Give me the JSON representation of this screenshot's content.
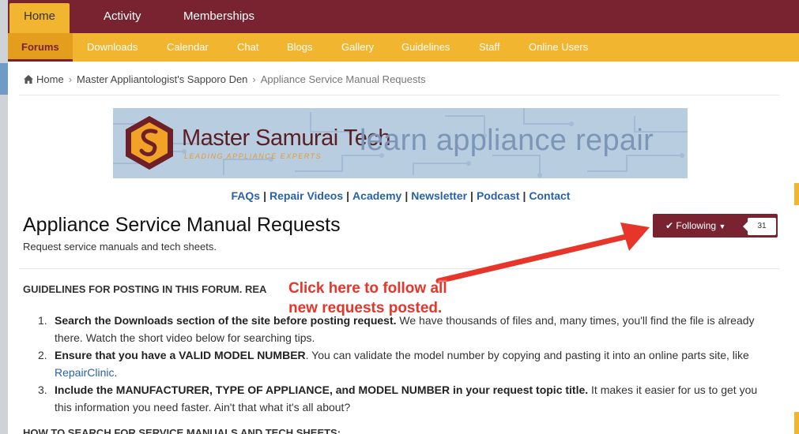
{
  "top_nav": {
    "tabs": [
      "Home",
      "Activity",
      "Memberships"
    ]
  },
  "sub_nav": {
    "items": [
      "Forums",
      "Downloads",
      "Calendar",
      "Chat",
      "Blogs",
      "Gallery",
      "Guidelines",
      "Staff",
      "Online Users"
    ]
  },
  "breadcrumb": {
    "items": [
      "Home",
      "Master Appliantologist's Sapporo Den",
      "Appliance Service Manual Requests"
    ]
  },
  "banner": {
    "brand": "Master Samurai Tech",
    "tagline": "LEADING APPLIANCE EXPERTS",
    "slogan": "learn appliance repair"
  },
  "links": [
    "FAQs",
    "Repair Videos",
    "Academy",
    "Newsletter",
    "Podcast",
    "Contact"
  ],
  "forum": {
    "title": "Appliance Service Manual Requests",
    "description": "Request service manuals and tech sheets.",
    "follow_label": "Following",
    "follow_count": "31"
  },
  "content": {
    "guidelines_heading": "GUIDELINES FOR POSTING IN THIS FORUM. REA",
    "rules": [
      {
        "num": "1.",
        "bold": "Search the Downloads section of the site before posting request.",
        "text": " We have thousands of files and, many times, you'll find the file is already there. Watch the short video below for searching tips."
      },
      {
        "num": "2.",
        "bold": "Ensure that you have a VALID MODEL NUMBER",
        "text": ". You can validate the model number by copying and pasting it into an online parts site, like ",
        "link": "RepairClinic",
        "after": "."
      },
      {
        "num": "3.",
        "bold": "Include  the MANUFACTURER, TYPE OF APPLIANCE, and MODEL NUMBER in your request topic title.",
        "text": " It makes it easier for us to get you this information you need faster. Ain't that what it's all about?"
      }
    ],
    "howto_heading": "HOW TO SEARCH FOR SERVICE MANUALS AND TECH SHEETS:"
  },
  "annotation": {
    "line1": "Click here to follow all",
    "line2": "new requests posted."
  },
  "colors": {
    "nav_maroon": "#7a2330",
    "nav_gold": "#f2b530",
    "link_blue": "#2a62a8",
    "annotation_red": "#e8352a"
  }
}
